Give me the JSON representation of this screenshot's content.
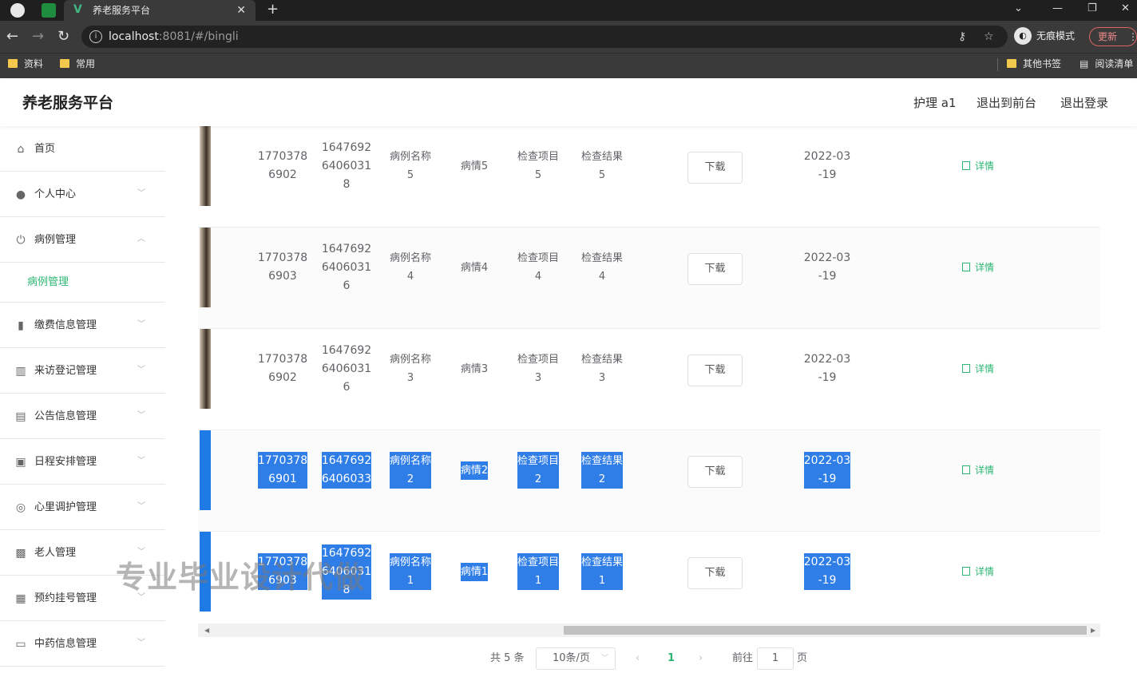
{
  "browser": {
    "tab_title": "养老服务平台",
    "url_host": "localhost",
    "url_rest": ":8081/#/bingli",
    "incognito_label": "无痕模式",
    "update_label": "更新",
    "bookmarks": [
      "资料",
      "常用"
    ],
    "bookmarks_right": [
      "其他书签",
      "阅读清单"
    ]
  },
  "header": {
    "title": "养老服务平台",
    "user": "护理 a1",
    "to_front": "退出到前台",
    "logout": "退出登录"
  },
  "sidebar": {
    "items": [
      {
        "label": "首页",
        "icon": "home-icon"
      },
      {
        "label": "个人中心",
        "icon": "user-icon"
      },
      {
        "label": "病例管理",
        "icon": "power-icon"
      },
      {
        "label": "病例管理",
        "icon": ""
      },
      {
        "label": "缴费信息管理",
        "icon": "bar-icon"
      },
      {
        "label": "来访登记管理",
        "icon": "chart-icon"
      },
      {
        "label": "公告信息管理",
        "icon": "clipboard-icon"
      },
      {
        "label": "日程安排管理",
        "icon": "briefcase-icon"
      },
      {
        "label": "心里调护管理",
        "icon": "compass-icon"
      },
      {
        "label": "老人管理",
        "icon": "doc-x-icon"
      },
      {
        "label": "预约挂号管理",
        "icon": "grid-icon"
      },
      {
        "label": "中药信息管理",
        "icon": "message-icon"
      }
    ]
  },
  "table": {
    "download_label": "下载",
    "detail_label": "详情",
    "rows": [
      {
        "phone": "1770378\n6902",
        "number": "1647692\n6406031\n8",
        "name": "病例名称\n5",
        "condition": "病情5",
        "item": "检查项目\n5",
        "result": "检查结果\n5",
        "date": "2022-03\n-19",
        "selected": false
      },
      {
        "phone": "1770378\n6903",
        "number": "1647692\n6406031\n6",
        "name": "病例名称\n4",
        "condition": "病情4",
        "item": "检查项目\n4",
        "result": "检查结果\n4",
        "date": "2022-03\n-19",
        "selected": false
      },
      {
        "phone": "1770378\n6902",
        "number": "1647692\n6406031\n6",
        "name": "病例名称\n3",
        "condition": "病情3",
        "item": "检查项目\n3",
        "result": "检查结果\n3",
        "date": "2022-03\n-19",
        "selected": false
      },
      {
        "phone": "1770378\n6901",
        "number": "1647692\n6406033",
        "name": "病例名称\n2",
        "condition": "病情2",
        "item": "检查项目\n2",
        "result": "检查结果\n2",
        "date": "2022-03\n-19",
        "selected": true
      },
      {
        "phone": "1770378\n6903",
        "number": "1647692\n6406031\n8",
        "name": "病例名称\n1",
        "condition": "病情1",
        "item": "检查项目\n1",
        "result": "检查结果\n1",
        "date": "2022-03\n-19",
        "selected": true
      }
    ]
  },
  "watermark": "专业毕业设计代做",
  "pagination": {
    "total": "共 5 条",
    "page_size": "10条/页",
    "current_page": "1",
    "goto_label": "前往",
    "goto_value": "1",
    "page_unit": "页"
  },
  "colors": {
    "accent": "#2bb673",
    "selection": "#2f7ee8"
  }
}
